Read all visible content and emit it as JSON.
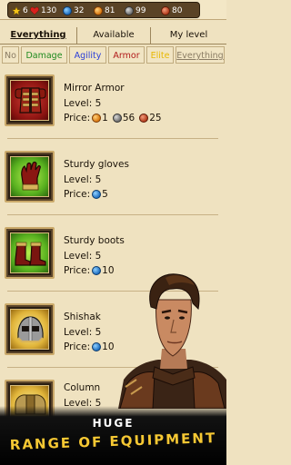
{
  "resources": [
    {
      "icon": "star-icon",
      "value": "6",
      "color": "#f5c518"
    },
    {
      "icon": "heart-icon",
      "value": "130",
      "color": "#d8211d"
    },
    {
      "icon": "blue-coin-icon",
      "value": "32",
      "color": "#1f6fc0"
    },
    {
      "icon": "orange-coin-icon",
      "value": "81",
      "color": "#d8770f"
    },
    {
      "icon": "grey-coin-icon",
      "value": "99",
      "color": "#6e6e6e"
    },
    {
      "icon": "red-coin-icon",
      "value": "80",
      "color": "#b33d1d"
    }
  ],
  "tabs": [
    {
      "label": "Everything",
      "active": true
    },
    {
      "label": "Available",
      "active": false
    },
    {
      "label": "My level",
      "active": false
    }
  ],
  "filters": [
    {
      "label": "No",
      "color": "#8a7c64"
    },
    {
      "label": "Damage",
      "color": "#1f8a1f"
    },
    {
      "label": "Agility",
      "color": "#2a3ed8"
    },
    {
      "label": "Armor",
      "color": "#b01818"
    },
    {
      "label": "Elite",
      "color": "#e8b800"
    },
    {
      "label": "Everything",
      "color": "#8a7c64"
    }
  ],
  "items": [
    {
      "name": "Mirror Armor",
      "level": "Level: 5",
      "price_label": "Price:",
      "prices": [
        {
          "coin": "orange",
          "value": "1"
        },
        {
          "coin": "grey",
          "value": "56"
        },
        {
          "coin": "red",
          "value": "25"
        }
      ],
      "icon": "armor-icon",
      "frame": "red"
    },
    {
      "name": "Sturdy gloves",
      "level": "Level: 5",
      "price_label": "Price:",
      "prices": [
        {
          "coin": "blue",
          "value": "5"
        }
      ],
      "icon": "gloves-icon",
      "frame": "green"
    },
    {
      "name": "Sturdy boots",
      "level": "Level: 5",
      "price_label": "Price:",
      "prices": [
        {
          "coin": "blue",
          "value": "10"
        }
      ],
      "icon": "boots-icon",
      "frame": "green"
    },
    {
      "name": "Shishak",
      "level": "Level: 5",
      "price_label": "Price:",
      "prices": [
        {
          "coin": "blue",
          "value": "10"
        }
      ],
      "icon": "helmet-icon",
      "frame": "gold"
    },
    {
      "name": "Column",
      "level": "Level: 5",
      "price_label": "",
      "prices": [],
      "icon": "shoulder-armor-icon",
      "frame": "gold"
    }
  ],
  "banner": {
    "line1": "HUGE",
    "line2": "RANGE OF EQUIPMENT"
  }
}
